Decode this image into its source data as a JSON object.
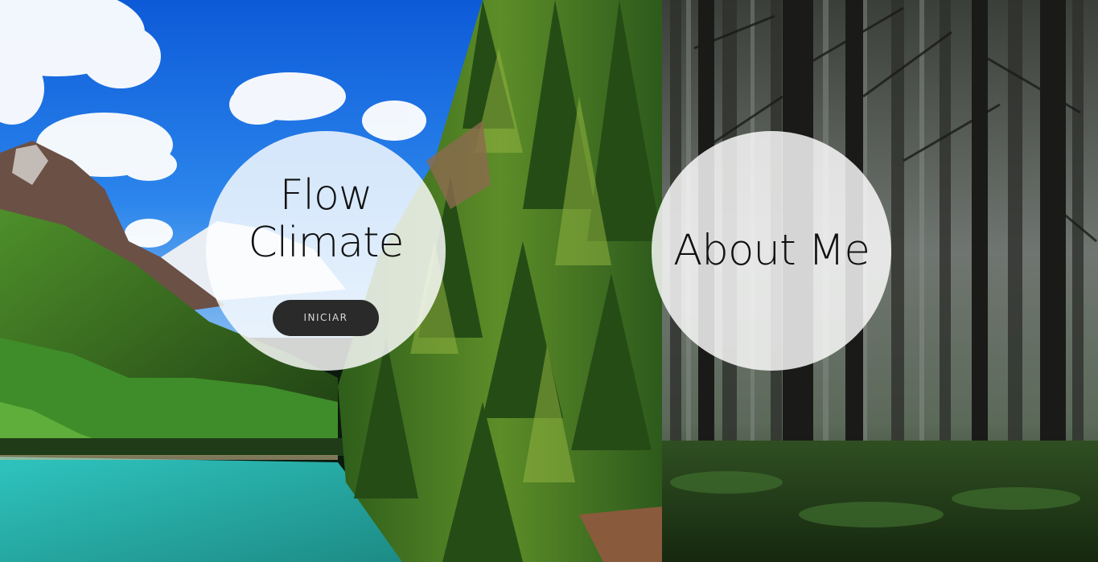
{
  "hero_left": {
    "title": "Flow Climate",
    "button_label": "INICIAR"
  },
  "hero_right": {
    "title": "About Me"
  },
  "colors": {
    "sky": "#1d6fe0",
    "lake": "#3ec9c0",
    "circle_bg": "#ffffff",
    "button_bg": "#2a2a2a",
    "button_text": "#d8d8d8",
    "title_text": "#111111"
  }
}
